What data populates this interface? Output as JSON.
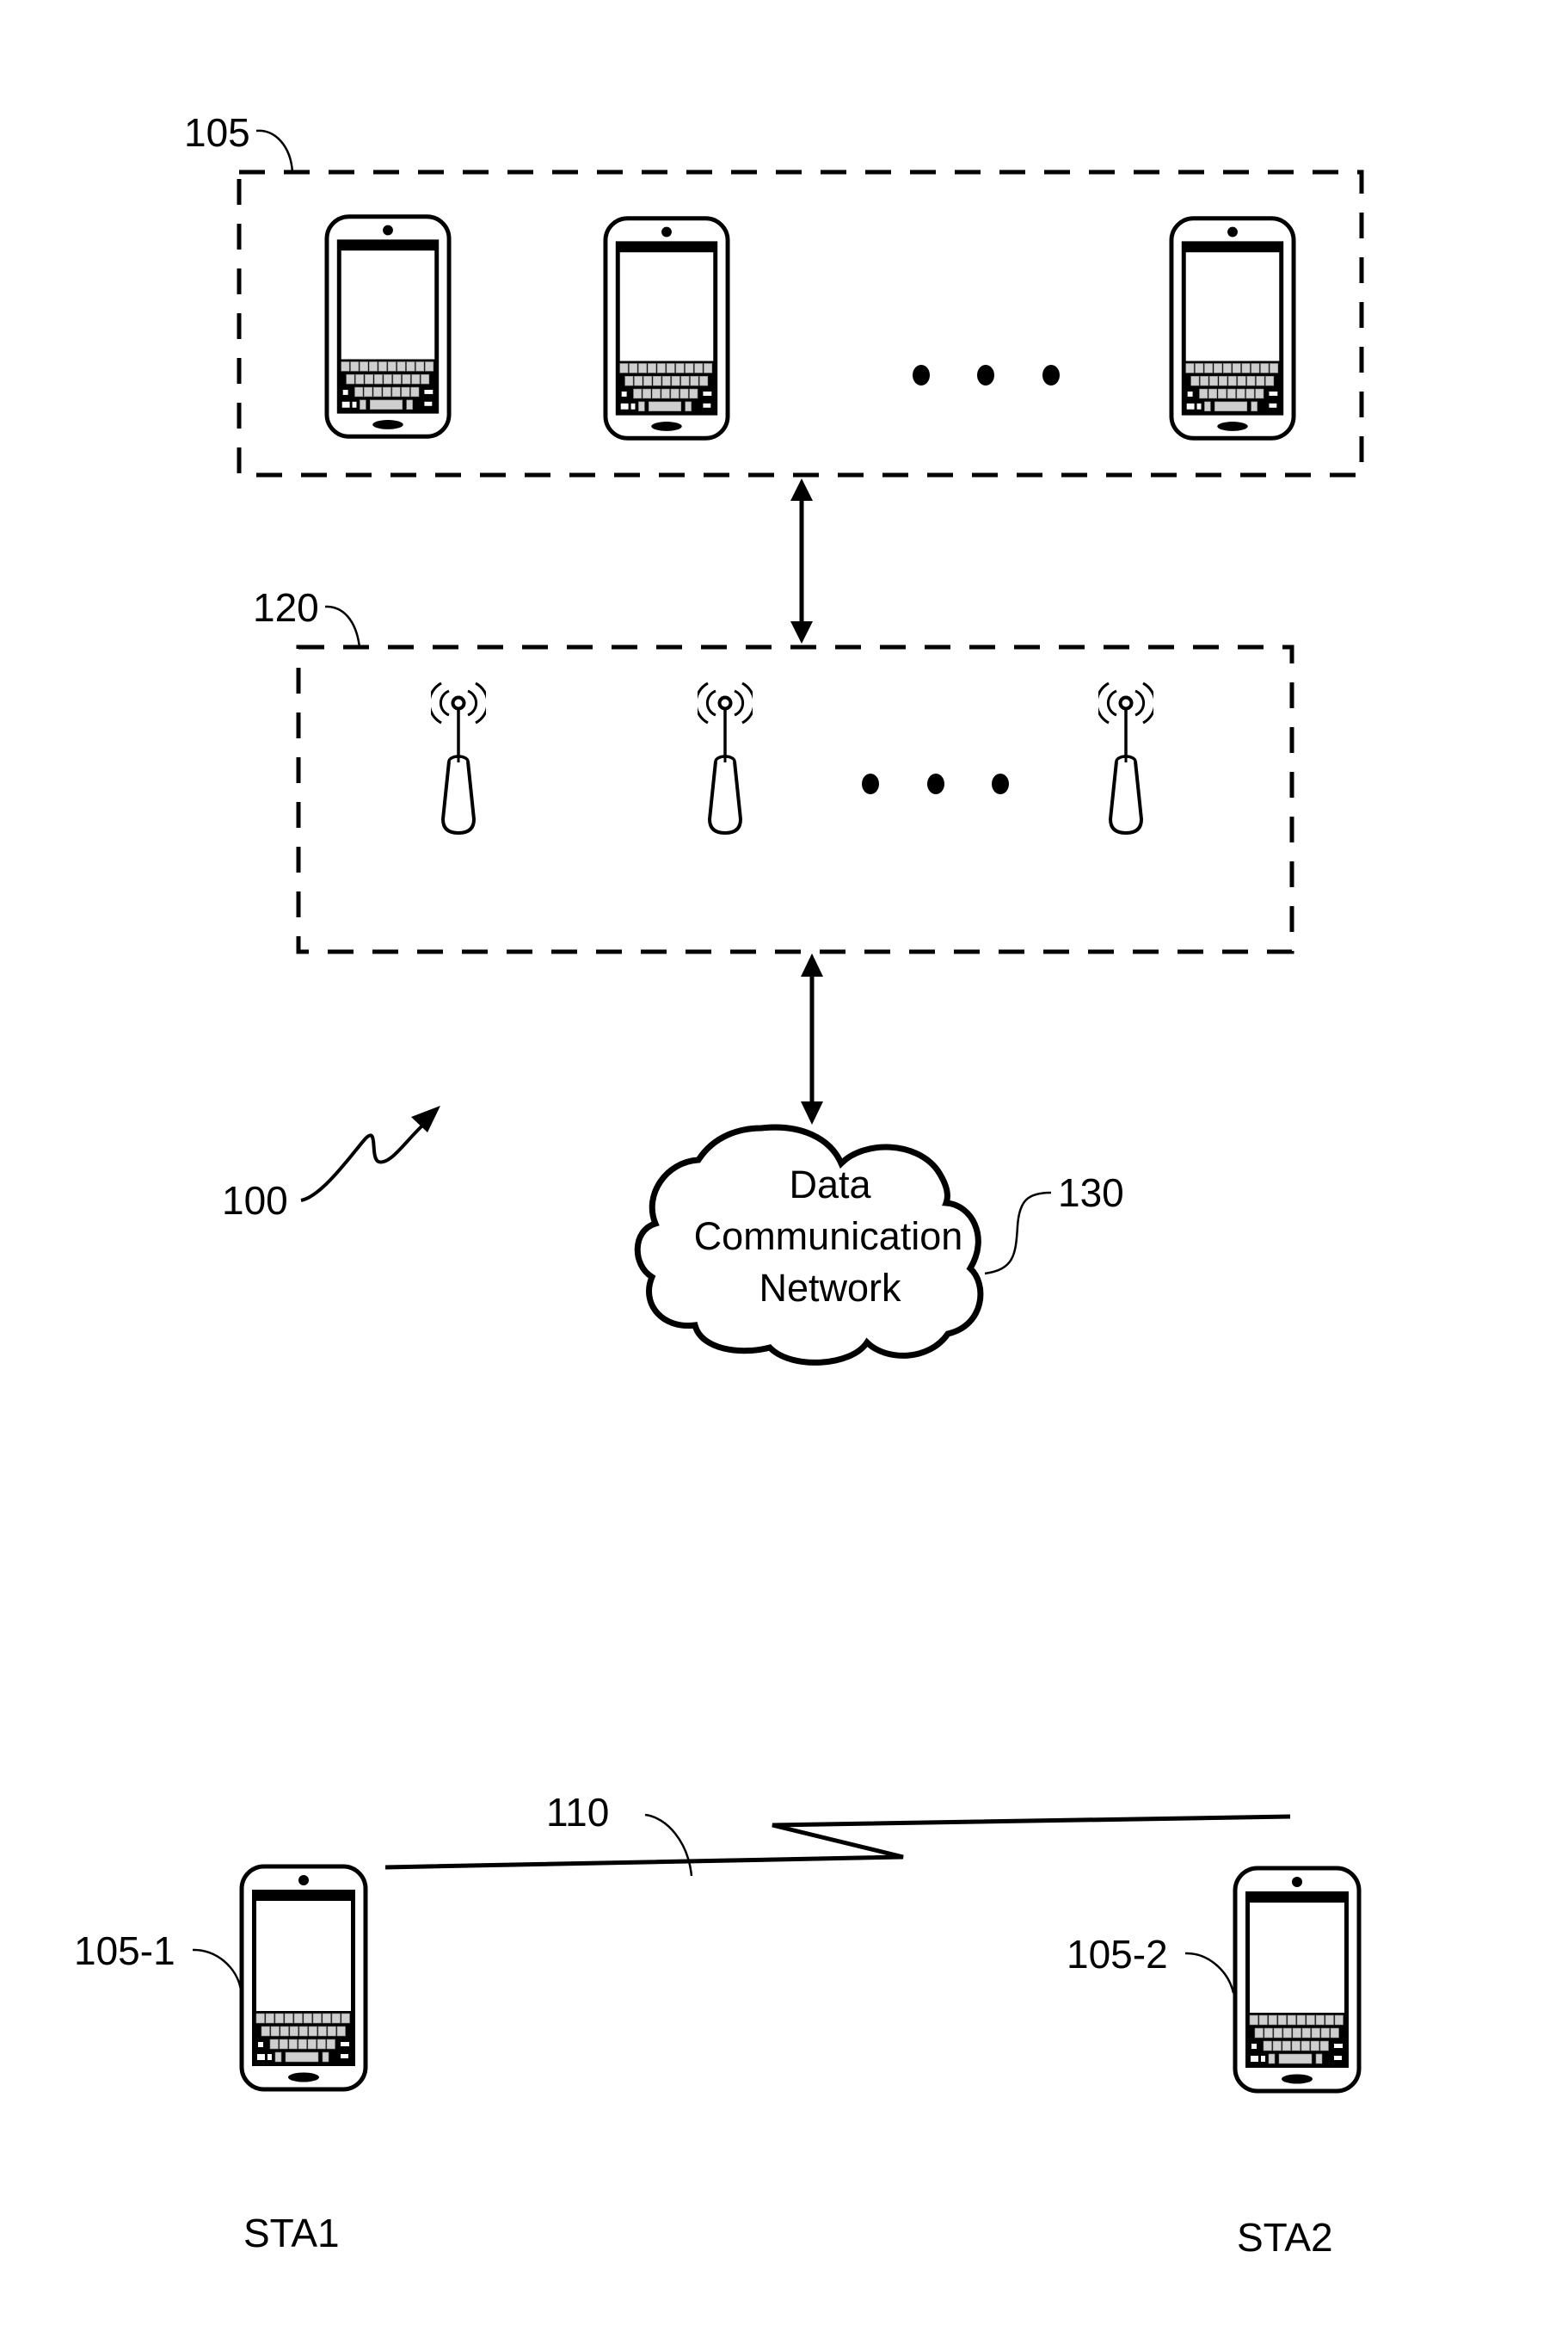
{
  "figure": {
    "system_ref": "100",
    "devices_group": {
      "ref": "105",
      "device_count_shown": 3,
      "ellipsis": true,
      "device_icon": "smartphone-icon"
    },
    "access_points_group": {
      "ref": "120",
      "ap_count_shown": 3,
      "ellipsis": true,
      "ap_icon": "wireless-antenna-icon"
    },
    "network": {
      "ref": "130",
      "lines": [
        "Data",
        "Communication",
        "Network"
      ],
      "icon": "cloud-icon"
    },
    "links": [
      {
        "from": "105",
        "to": "120",
        "type": "bidirectional-arrow"
      },
      {
        "from": "120",
        "to": "130",
        "type": "bidirectional-arrow"
      }
    ],
    "direct_link": {
      "ref": "110",
      "type": "wireless-lightning-link"
    },
    "stations": [
      {
        "ref": "105-1",
        "name": "STA1"
      },
      {
        "ref": "105-2",
        "name": "STA2"
      }
    ]
  },
  "colors": {
    "stroke": "#000000",
    "background": "#ffffff"
  }
}
